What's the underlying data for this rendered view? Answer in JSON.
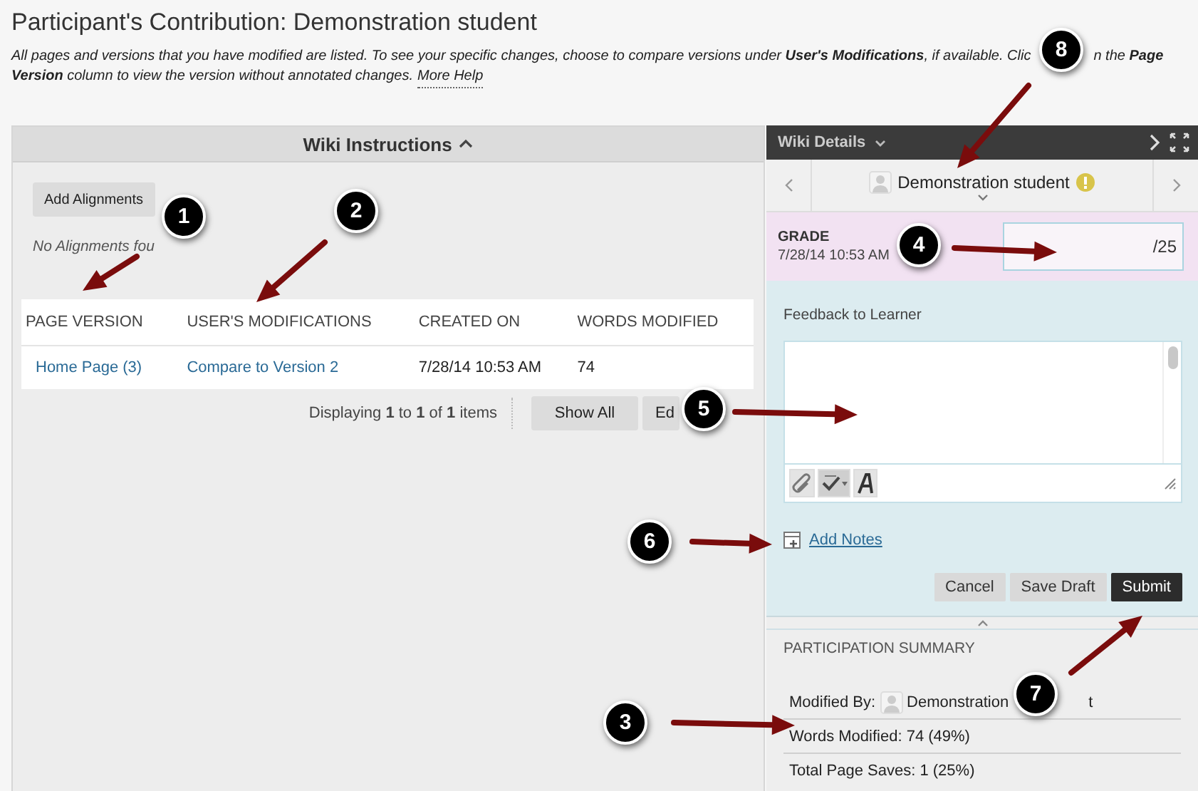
{
  "page": {
    "title": "Participant's Contribution: Demonstration student",
    "description_line_1": [
      "All pages and versions that you have modified are listed. To see your specific changes, choose to compare versions under **User's Modifications**, if available. Clic",
      "n the **Page**"
    ],
    "description_line_2": "**Version** column to view the version without annotated changes.",
    "help_link": "More Help"
  },
  "wiki_instructions": {
    "title": "Wiki Instructions",
    "add_alignments_button": "Add Alignments",
    "no_alignments_text": "No Alignments fou",
    "table": {
      "columns": [
        "PAGE VERSION",
        "USER'S MODIFICATIONS",
        "CREATED ON",
        "WORDS MODIFIED"
      ],
      "rows": [
        {
          "cells": [
            {
              "text": "Home Page (3)",
              "kind": "link"
            },
            {
              "text": "Compare to Version 2",
              "kind": "link"
            },
            {
              "text": "7/28/14 10:53 AM",
              "kind": "text"
            },
            {
              "text": "74",
              "kind": "text"
            }
          ]
        }
      ]
    },
    "pagination": {
      "text": "Displaying **1** to **1** of **1** items",
      "buttons": [
        "Show All",
        "Ed"
      ]
    }
  },
  "wiki_details": {
    "title": "Wiki Details",
    "student": "Demonstration student",
    "needs_grading": true,
    "grade": {
      "label": "GRADE",
      "date": "7/28/14 10:53 AM",
      "max": "/25"
    },
    "feedback": {
      "label": "Feedback to Learner",
      "add_notes_link": "Add Notes"
    },
    "buttons": [
      {
        "label": "Cancel",
        "primary": false
      },
      {
        "label": "Save Draft",
        "primary": false
      },
      {
        "label": "Submit",
        "primary": true
      }
    ],
    "summary": {
      "title": "PARTICIPATION SUMMARY",
      "modified_by_label": "Modified By:",
      "modified_by_name": "Demonstration",
      "modified_by_tail": "t",
      "rows": [
        "Words Modified: 74 (49%)",
        "Total Page Saves: 1 (25%)"
      ]
    }
  },
  "callouts": [
    {
      "number": "1"
    },
    {
      "number": "2"
    },
    {
      "number": "3"
    },
    {
      "number": "4"
    },
    {
      "number": "5"
    },
    {
      "number": "6"
    },
    {
      "number": "7"
    },
    {
      "number": "8"
    }
  ]
}
